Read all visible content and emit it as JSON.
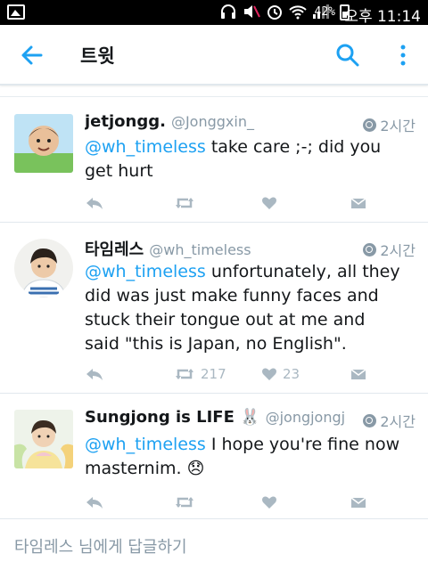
{
  "statusbar": {
    "battery": "42%",
    "clock": "오후 11:14",
    "icons": [
      "gallery-icon",
      "headphones-icon",
      "mute-icon",
      "alarm-icon",
      "wifi-icon",
      "signal-icon",
      "battery-icon"
    ]
  },
  "appbar": {
    "title": "트윗",
    "icons": [
      "back-arrow-icon",
      "search-icon",
      "more-vert-icon"
    ]
  },
  "colors": {
    "accent": "#1da1f2",
    "muted": "#8899a6",
    "action": "#aab8c2",
    "text": "#14171a"
  },
  "tweets": [
    {
      "name": "jetjongg.",
      "handle": "@Jonggxin_",
      "time": "2시간",
      "mention": "@wh_timeless",
      "text": " take care ;-; did you get hurt",
      "retweets": "",
      "likes": ""
    },
    {
      "name": "타임레스",
      "handle": "@wh_timeless",
      "time": "2시간",
      "mention": "@wh_timeless",
      "text": " unfortunately, all they did was just make funny faces and stuck their tongue out at me and said \"this is Japan, no English\".",
      "retweets": "217",
      "likes": "23"
    },
    {
      "name": "Sungjong is LIFE 🐰",
      "handle": "@jongjongjo...",
      "time": "2시간",
      "mention": "@wh_timeless",
      "text": " I hope you're fine now masternim. 😞",
      "retweets": "",
      "likes": ""
    }
  ],
  "reply_placeholder": "타임레스 님에게 답글하기"
}
